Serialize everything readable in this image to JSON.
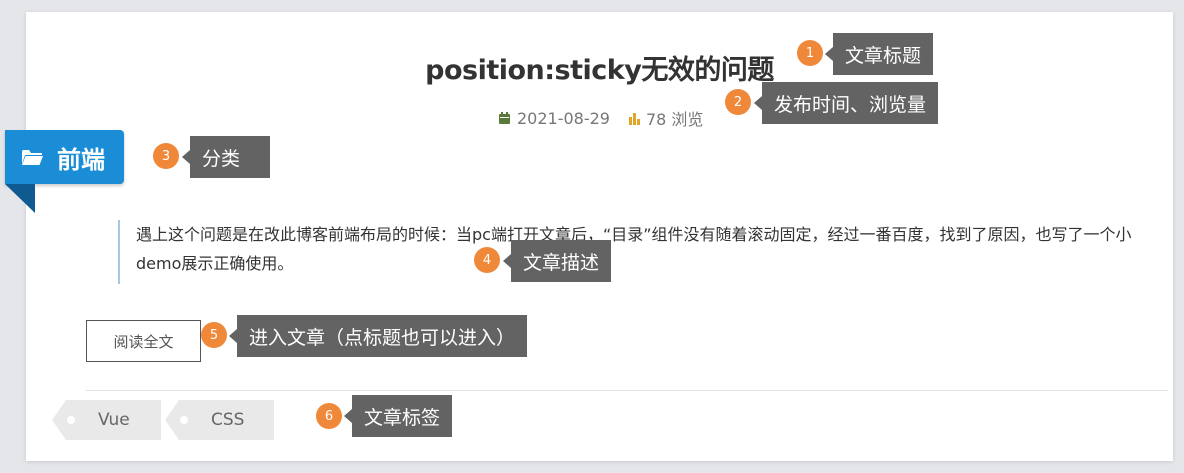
{
  "article": {
    "title": "position:sticky无效的问题",
    "date": "2021-08-29",
    "views": "78 浏览",
    "category": "前端",
    "description": "遇上这个问题是在改此博客前端布局的时候：当pc端打开文章后，“目录”组件没有随着滚动固定，经过一番百度，找到了原因，也写了一个小demo展示正确使用。",
    "read_more_label": "阅读全文",
    "tags": [
      {
        "label": "Vue"
      },
      {
        "label": "CSS"
      }
    ]
  },
  "annotations": [
    {
      "number": "1",
      "text": "文章标题"
    },
    {
      "number": "2",
      "text": "发布时间、浏览量"
    },
    {
      "number": "3",
      "text": "分类"
    },
    {
      "number": "4",
      "text": "文章描述"
    },
    {
      "number": "5",
      "text": "进入文章（点标题也可以进入）"
    },
    {
      "number": "6",
      "text": "文章标签"
    }
  ],
  "colors": {
    "ribbon": "#1b8cd6",
    "badge": "#f0883a",
    "callout": "#636363",
    "calendar_icon": "#5a7a3a",
    "chart_icon": "#e0a526"
  },
  "icons": {
    "date": "calendar-icon",
    "views": "bar-chart-icon",
    "category": "folder-open-icon"
  }
}
